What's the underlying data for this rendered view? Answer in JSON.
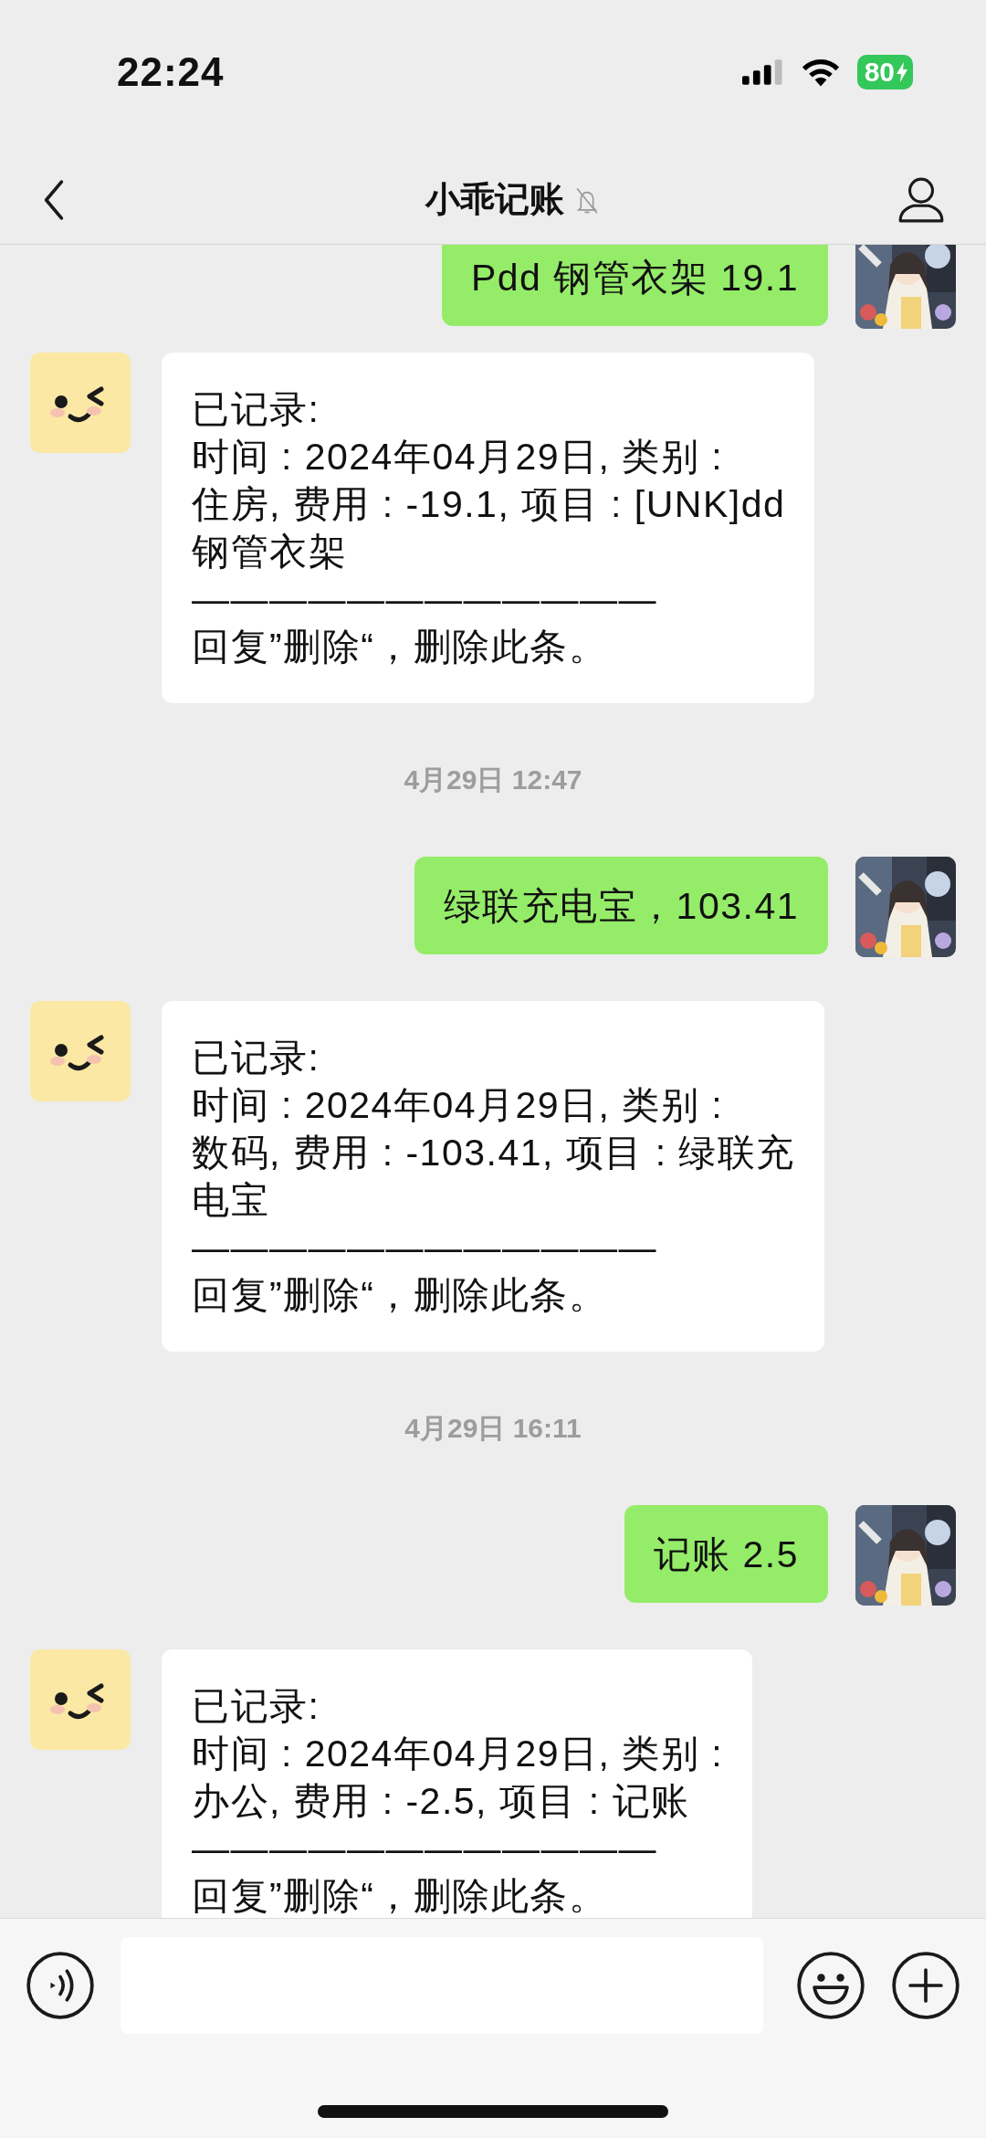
{
  "status_bar": {
    "time": "22:24",
    "battery": "80"
  },
  "header": {
    "title": "小乖记账",
    "muted": true
  },
  "messages": [
    {
      "kind": "sent",
      "text": "Pdd 钢管衣架 19.1"
    },
    {
      "kind": "received",
      "lines": [
        "已记录:",
        "时间 : 2024年04月29日, 类别 :",
        "住房, 费用 : -19.1, 项目 : [UNK]dd",
        "钢管衣架",
        "————————————",
        "回复”删除“，删除此条。"
      ]
    },
    {
      "kind": "time",
      "text": "4月29日 12:47"
    },
    {
      "kind": "sent",
      "text": "绿联充电宝，103.41"
    },
    {
      "kind": "received",
      "lines": [
        "已记录:",
        "时间 : 2024年04月29日, 类别 :",
        "数码, 费用 : -103.41, 项目 : 绿联充",
        "电宝",
        "————————————",
        "回复”删除“，删除此条。"
      ]
    },
    {
      "kind": "time",
      "text": "4月29日 16:11"
    },
    {
      "kind": "sent",
      "text": "记账 2.5"
    },
    {
      "kind": "received",
      "lines": [
        "已记录:",
        "时间 : 2024年04月29日, 类别 :",
        "办公, 费用 : -2.5, 项目 : 记账",
        "————————————",
        "回复”删除“，删除此条。"
      ]
    }
  ]
}
